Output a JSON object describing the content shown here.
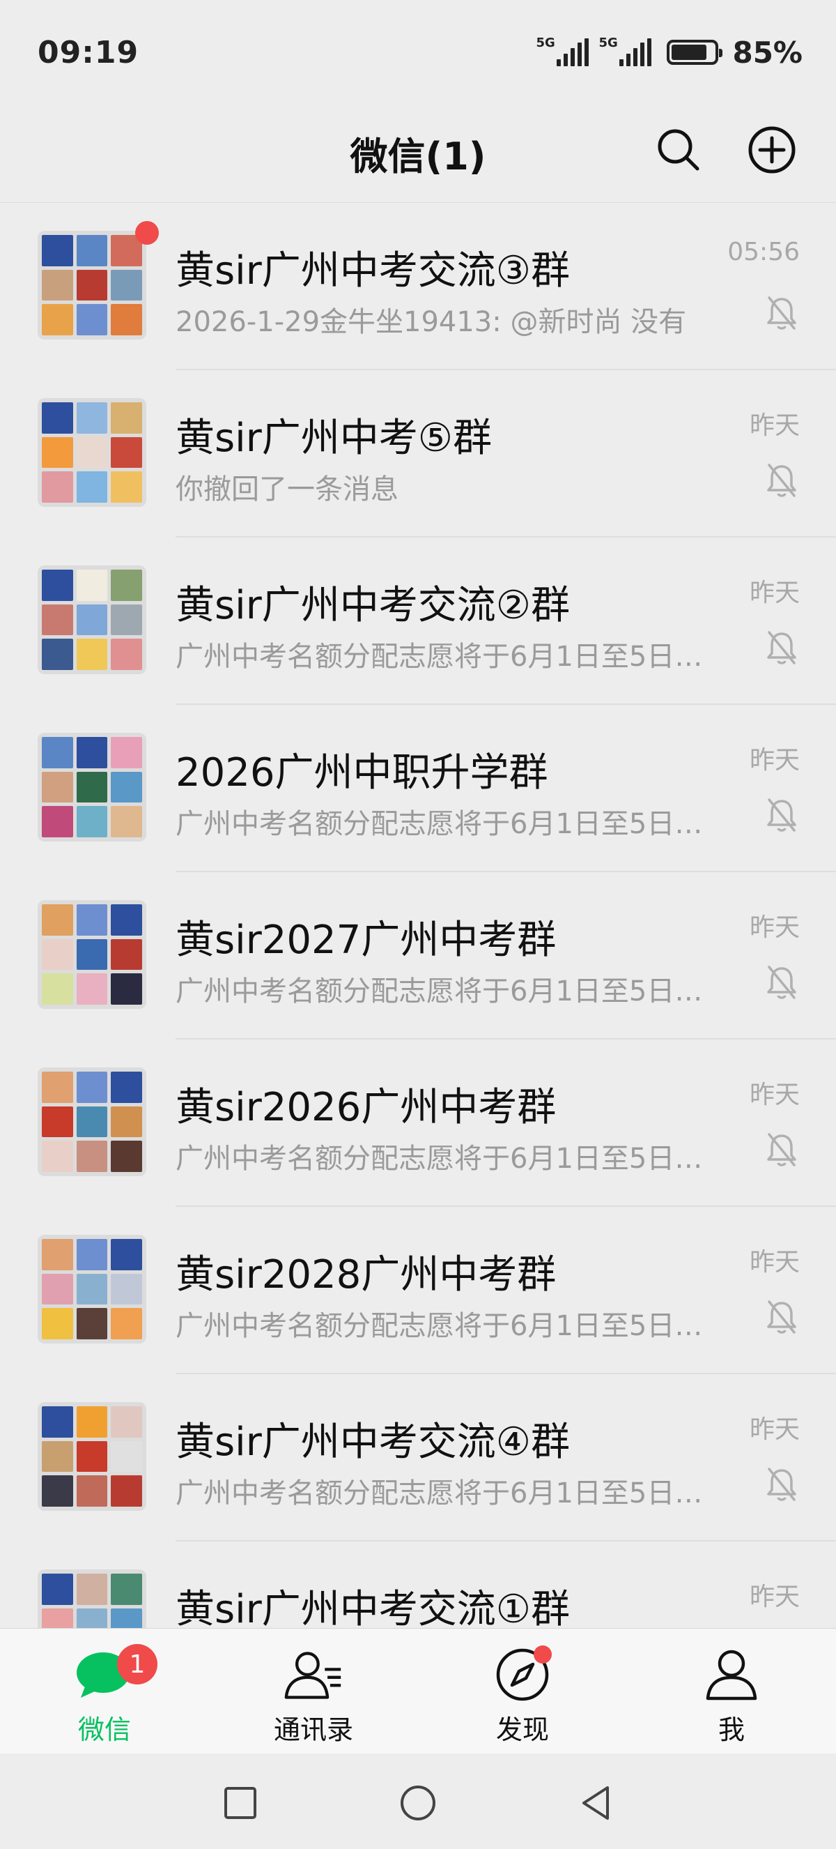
{
  "status_bar": {
    "time": "09:19",
    "network1": "5G",
    "network2": "5G",
    "battery_percent": "85%"
  },
  "header": {
    "title": "微信(1)",
    "search_icon": "search-icon",
    "add_icon": "plus-circle-icon"
  },
  "chats": [
    {
      "name": "黄sir广州中考交流③群",
      "preview": "2026-1-29金牛坐19413: @新时尚 没有",
      "time": "05:56",
      "unread_dot": true,
      "muted": true,
      "avatar": [
        "#2d4f9e",
        "#5a86c5",
        "#d26b5b",
        "#c9a07e",
        "#b83b32",
        "#7a9bb8",
        "#e8a24a",
        "#6d8fd0",
        "#e07c3c"
      ]
    },
    {
      "name": "黄sir广州中考⑤群",
      "preview": "你撤回了一条消息",
      "time": "昨天",
      "unread_dot": false,
      "muted": true,
      "avatar": [
        "#2d4f9e",
        "#8fb6de",
        "#d8b070",
        "#f29a3c",
        "#e8d8d0",
        "#c94a3a",
        "#e09aa0",
        "#7fb5e0",
        "#f0c060"
      ]
    },
    {
      "name": "黄sir广州中考交流②群",
      "preview": "广州中考名额分配志愿将于6月1日至5日…",
      "time": "昨天",
      "unread_dot": false,
      "muted": true,
      "avatar": [
        "#2d4f9e",
        "#f0ede0",
        "#86a070",
        "#c87a70",
        "#7fa7d8",
        "#9ea8b0",
        "#3a5a90",
        "#f0c858",
        "#e09090"
      ]
    },
    {
      "name": "2026广州中职升学群",
      "preview": "广州中考名额分配志愿将于6月1日至5日…",
      "time": "昨天",
      "unread_dot": false,
      "muted": true,
      "avatar": [
        "#5a86c5",
        "#2d4f9e",
        "#e8a0b8",
        "#d0a080",
        "#2f6a4a",
        "#5a98c8",
        "#c04a7a",
        "#6db0c8",
        "#e0b890"
      ]
    },
    {
      "name": "黄sir2027广州中考群",
      "preview": "广州中考名额分配志愿将于6月1日至5日…",
      "time": "昨天",
      "unread_dot": false,
      "muted": true,
      "avatar": [
        "#e0a060",
        "#6d8fd0",
        "#2d4f9e",
        "#e8d0c8",
        "#3a6ab0",
        "#b83b32",
        "#d8e0a0",
        "#e8b0c0",
        "#2a2a40"
      ]
    },
    {
      "name": "黄sir2026广州中考群",
      "preview": "广州中考名额分配志愿将于6月1日至5日…",
      "time": "昨天",
      "unread_dot": false,
      "muted": true,
      "avatar": [
        "#e0a070",
        "#6d8fd0",
        "#2d4f9e",
        "#c83a2a",
        "#4a8ab0",
        "#d09050",
        "#e8d0c8",
        "#c89080",
        "#5a3a30"
      ]
    },
    {
      "name": "黄sir2028广州中考群",
      "preview": "广州中考名额分配志愿将于6月1日至5日…",
      "time": "昨天",
      "unread_dot": false,
      "muted": true,
      "avatar": [
        "#e0a070",
        "#6d8fd0",
        "#2d4f9e",
        "#e0a0b0",
        "#8ab0d0",
        "#c0c8d8",
        "#f0c040",
        "#5a4038",
        "#f0a050"
      ]
    },
    {
      "name": "黄sir广州中考交流④群",
      "preview": "广州中考名额分配志愿将于6月1日至5日…",
      "time": "昨天",
      "unread_dot": false,
      "muted": true,
      "avatar": [
        "#2d4f9e",
        "#f0a030",
        "#e0c8c0",
        "#c8a070",
        "#c83a2a",
        "#e0e0e0",
        "#3a3a48",
        "#c06a5a",
        "#b83b32"
      ]
    },
    {
      "name": "黄sir广州中考交流①群",
      "preview": "",
      "time": "昨天",
      "unread_dot": false,
      "muted": false,
      "avatar": [
        "#2d4f9e",
        "#d0b0a0",
        "#4a8a70",
        "#e8a0a0",
        "#8ab0d0",
        "#5a98c8",
        "#e0c080",
        "#6a8ab0",
        "#c0a090"
      ]
    }
  ],
  "tab_bar": {
    "tabs": [
      {
        "label": "微信",
        "icon": "chat-bubble-icon",
        "active": true,
        "badge": "1"
      },
      {
        "label": "通讯录",
        "icon": "contacts-icon",
        "active": false
      },
      {
        "label": "发现",
        "icon": "compass-icon",
        "active": false,
        "dot": true
      },
      {
        "label": "我",
        "icon": "person-icon",
        "active": false
      }
    ]
  },
  "nav_bar": {
    "buttons": [
      "recents-icon",
      "home-icon",
      "back-icon"
    ]
  },
  "colors": {
    "accent": "#07c160",
    "badge": "#f04a4a",
    "background": "#ededed"
  }
}
